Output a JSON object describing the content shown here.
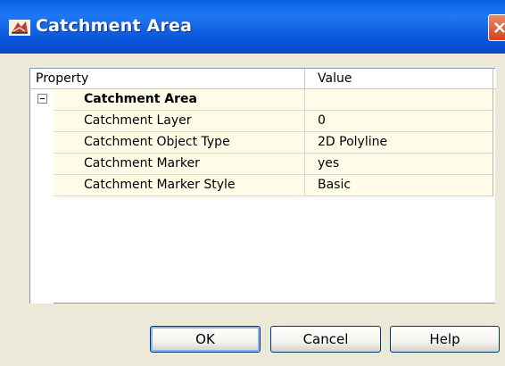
{
  "window": {
    "title": "Catchment Area",
    "icon": "app-icon",
    "close_icon": "close-icon"
  },
  "grid": {
    "headers": {
      "property": "Property",
      "value": "Value"
    },
    "category": {
      "label": "Catchment Area",
      "expander_icon": "collapse-icon"
    },
    "rows": [
      {
        "name": "Catchment Layer",
        "value": "0"
      },
      {
        "name": "Catchment Object Type",
        "value": "2D Polyline"
      },
      {
        "name": "Catchment Marker",
        "value": "yes"
      },
      {
        "name": "Catchment Marker Style",
        "value": "Basic"
      }
    ]
  },
  "buttons": {
    "ok": "OK",
    "cancel": "Cancel",
    "help": "Help"
  },
  "colors": {
    "titlebar": "#0a5fe6",
    "dialog_bg": "#ece9d8",
    "row_bg": "#fffde8"
  }
}
